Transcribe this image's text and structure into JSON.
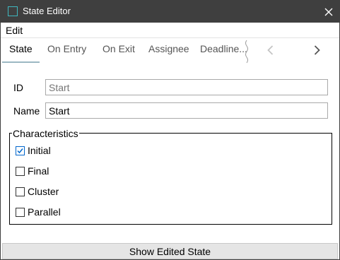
{
  "window": {
    "title": "State Editor"
  },
  "menu": {
    "edit_label": "Edit"
  },
  "tabs": [
    {
      "label": "State",
      "active": true
    },
    {
      "label": "On Entry",
      "active": false
    },
    {
      "label": "On Exit",
      "active": false
    },
    {
      "label": "Assignee",
      "active": false
    },
    {
      "label": "Deadline...",
      "active": false
    }
  ],
  "tab_nav": {
    "prev_icon": "chevron-left-icon",
    "next_icon": "chevron-right-icon"
  },
  "fields": {
    "id_label": "ID",
    "id_placeholder": "Start",
    "id_value": "",
    "name_label": "Name",
    "name_value": "Start"
  },
  "characteristics": {
    "legend": "Characteristics",
    "options": [
      {
        "label": "Initial",
        "checked": true
      },
      {
        "label": "Final",
        "checked": false
      },
      {
        "label": "Cluster",
        "checked": false
      },
      {
        "label": "Parallel",
        "checked": false
      }
    ]
  },
  "footer": {
    "show_button_label": "Show Edited State"
  },
  "colors": {
    "titlebar": "#3f3f3f",
    "accent": "#3fb8c0",
    "check_accent": "#0066cc",
    "tab_underline": "#9cb8c3"
  }
}
